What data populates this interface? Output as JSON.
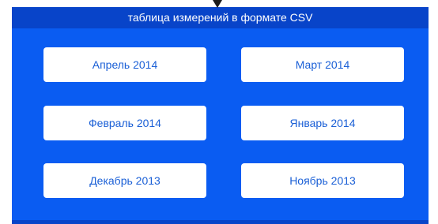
{
  "header": {
    "title": "таблица измерений в формате CSV"
  },
  "months": [
    {
      "label": "Апрель 2014"
    },
    {
      "label": "Март 2014"
    },
    {
      "label": "Февраль 2014"
    },
    {
      "label": "Январь 2014"
    },
    {
      "label": "Декабрь 2013"
    },
    {
      "label": "Ноябрь 2013"
    }
  ],
  "colors": {
    "panel": "#0a5cf2",
    "header": "#0844c9",
    "button_text": "#1a5fd6"
  }
}
